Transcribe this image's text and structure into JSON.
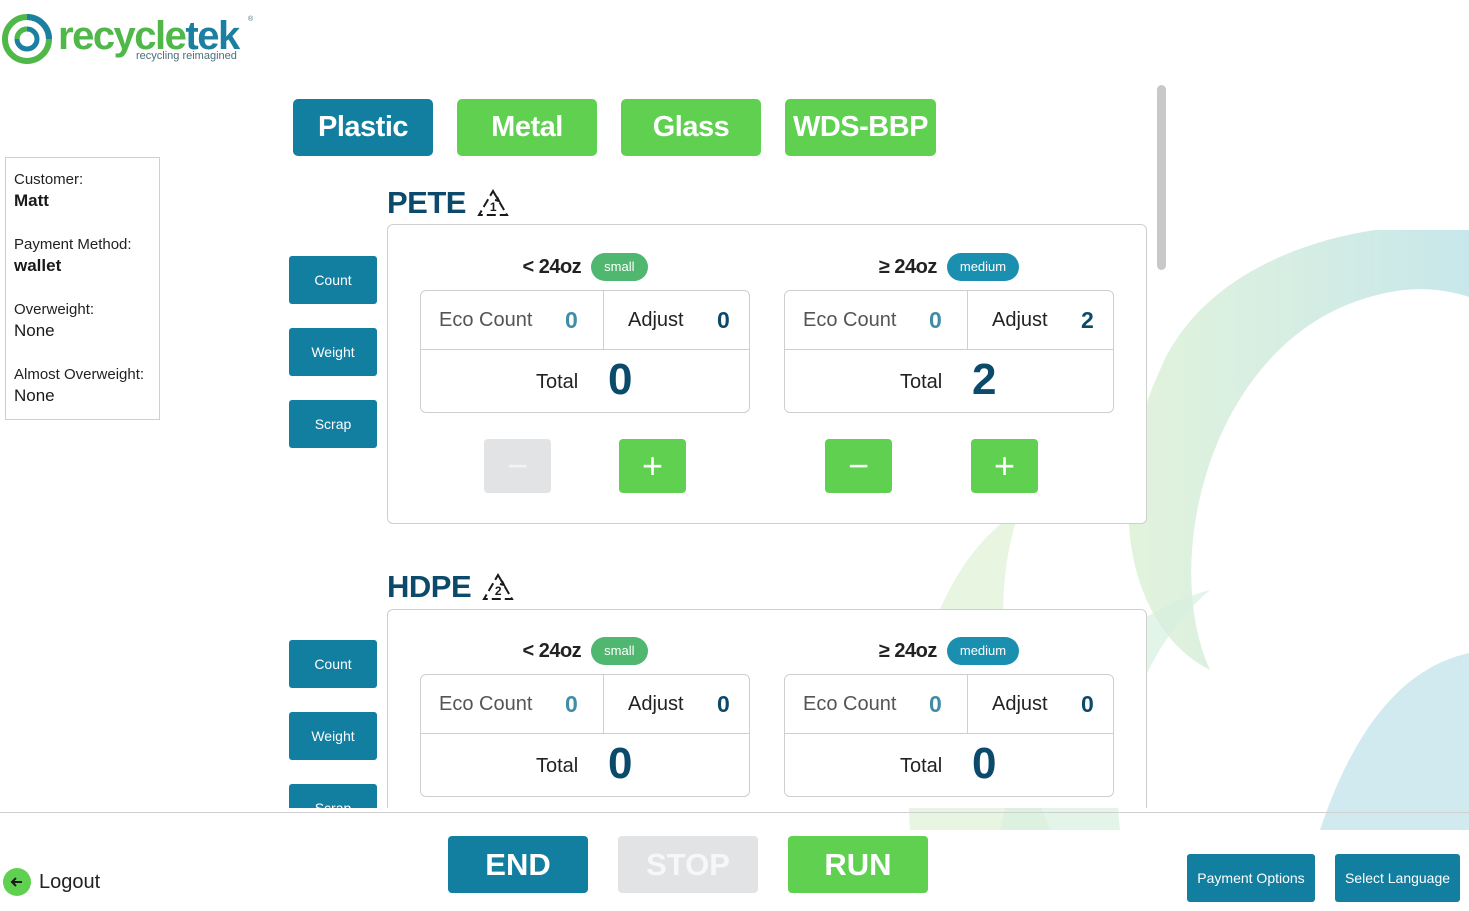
{
  "brand": {
    "name_part1": "recycle",
    "name_part2": "tek",
    "tagline": "recycling reimagined",
    "reg": "®"
  },
  "customer_panel": {
    "customer_label": "Customer:",
    "customer_value": "Matt",
    "payment_label": "Payment Method:",
    "payment_value": "wallet",
    "overweight_label": "Overweight:",
    "overweight_value": "None",
    "almost_label": "Almost Overweight:",
    "almost_value": "None"
  },
  "tabs": [
    {
      "label": "Plastic",
      "active": true
    },
    {
      "label": "Metal",
      "active": false
    },
    {
      "label": "Glass",
      "active": false
    },
    {
      "label": "WDS-BBP",
      "active": false
    }
  ],
  "side_buttons": {
    "count": "Count",
    "weight": "Weight",
    "scrap": "Scrap"
  },
  "materials": [
    {
      "name": "PETE",
      "code": "1",
      "sizes": [
        {
          "label": "< 24oz",
          "badge": "small",
          "eco_label": "Eco Count",
          "eco_value": "0",
          "adjust_label": "Adjust",
          "adjust_value": "0",
          "total_label": "Total",
          "total_value": "0",
          "minus_enabled": false,
          "minus": "−",
          "plus": "+"
        },
        {
          "label": "≥ 24oz",
          "badge": "medium",
          "eco_label": "Eco Count",
          "eco_value": "0",
          "adjust_label": "Adjust",
          "adjust_value": "2",
          "total_label": "Total",
          "total_value": "2",
          "minus_enabled": true,
          "minus": "−",
          "plus": "+"
        }
      ]
    },
    {
      "name": "HDPE",
      "code": "2",
      "sizes": [
        {
          "label": "< 24oz",
          "badge": "small",
          "eco_label": "Eco Count",
          "eco_value": "0",
          "adjust_label": "Adjust",
          "adjust_value": "0",
          "total_label": "Total",
          "total_value": "0"
        },
        {
          "label": "≥ 24oz",
          "badge": "medium",
          "eco_label": "Eco Count",
          "eco_value": "0",
          "adjust_label": "Adjust",
          "adjust_value": "0",
          "total_label": "Total",
          "total_value": "0"
        }
      ]
    }
  ],
  "controls": {
    "end": "END",
    "stop": "STOP",
    "run": "RUN"
  },
  "footer": {
    "logout": "Logout",
    "payment_options": "Payment Options",
    "select_language": "Select Language"
  },
  "colors": {
    "primary_blue": "#127ea0",
    "accent_green": "#5fd04f",
    "heading_navy": "#0b4a6a",
    "disabled": "#e2e3e5"
  }
}
